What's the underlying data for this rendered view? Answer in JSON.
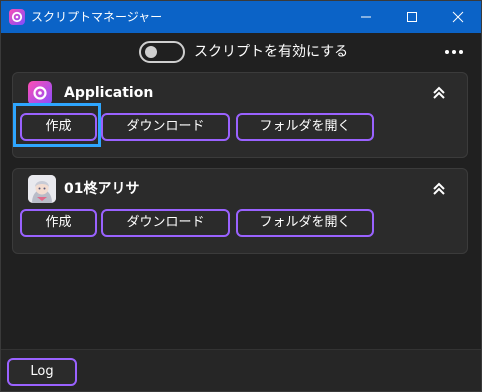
{
  "window": {
    "title": "スクリプトマネージャー"
  },
  "toolbar": {
    "toggle_label": "スクリプトを有効にする",
    "toggle_on": false
  },
  "cards": [
    {
      "title": "Application",
      "icon": "app-logo-icon",
      "buttons": {
        "create": "作成",
        "download": "ダウンロード",
        "open_folder": "フォルダを開く"
      }
    },
    {
      "title": "01柊アリサ",
      "icon": "character-avatar-icon",
      "buttons": {
        "create": "作成",
        "download": "ダウンロード",
        "open_folder": "フォルダを開く"
      }
    }
  ],
  "footer": {
    "log_label": "Log"
  },
  "colors": {
    "titlebar": "#0b63c7",
    "accent": "#9a62ff",
    "focus": "#2ea6ff",
    "background": "#202020",
    "card": "#2b2b2b"
  }
}
